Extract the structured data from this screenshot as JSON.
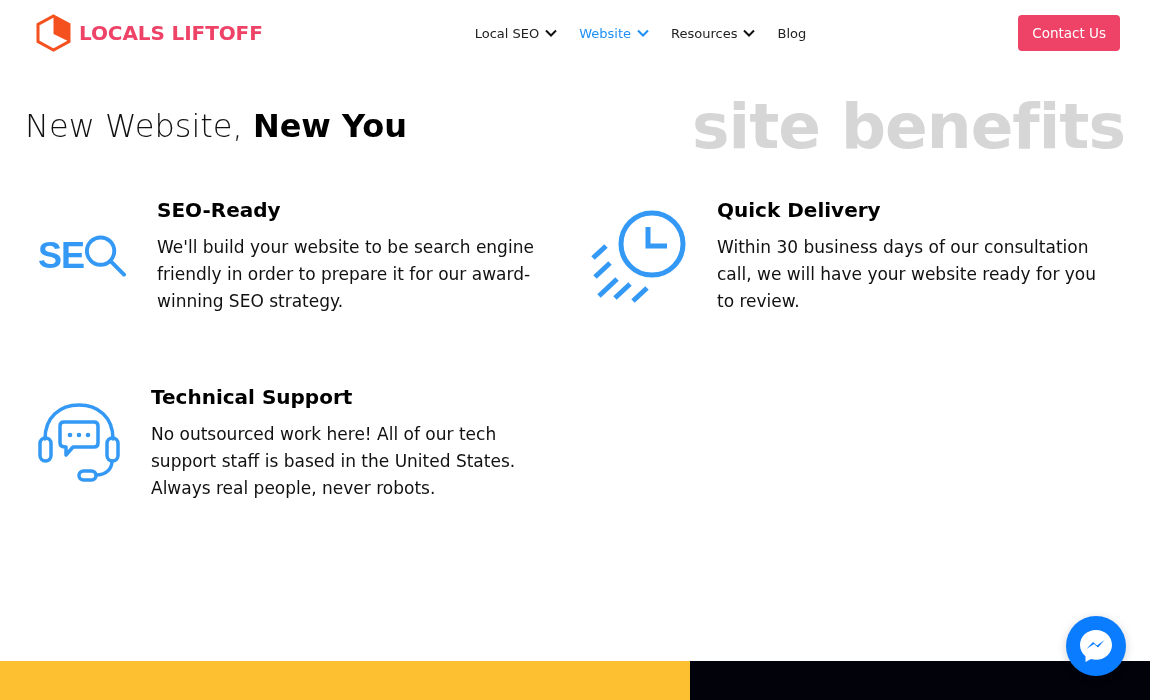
{
  "header": {
    "logo": {
      "text": "LOCALS LIFTOFF"
    },
    "nav": [
      {
        "label": "Local SEO",
        "selected": false,
        "has_menu": true
      },
      {
        "label": "Website",
        "selected": true,
        "has_menu": true
      },
      {
        "label": "Resources",
        "selected": false,
        "has_menu": true
      },
      {
        "label": "Blog",
        "selected": false,
        "has_menu": false
      }
    ],
    "cta_button": "Contact Us"
  },
  "hero": {
    "heading": "New Website, **New You**",
    "background_title": "site benefits"
  },
  "features": [
    {
      "kind": "seo",
      "icon_text": "SE",
      "title": "SEO-Ready",
      "description": "We'll build your website to be search engine friendly in order to prepare it for our award-winning SEO strategy."
    },
    {
      "kind": "delivery",
      "title": "Quick Delivery",
      "description": "Within 30 business days of our consultation call, we will have your website ready for you to review."
    },
    {
      "kind": "support",
      "title": "Technical Support",
      "description": "No outsourced work here! All of our tech support staff is based in the United States. Always real people, never robots."
    }
  ]
}
